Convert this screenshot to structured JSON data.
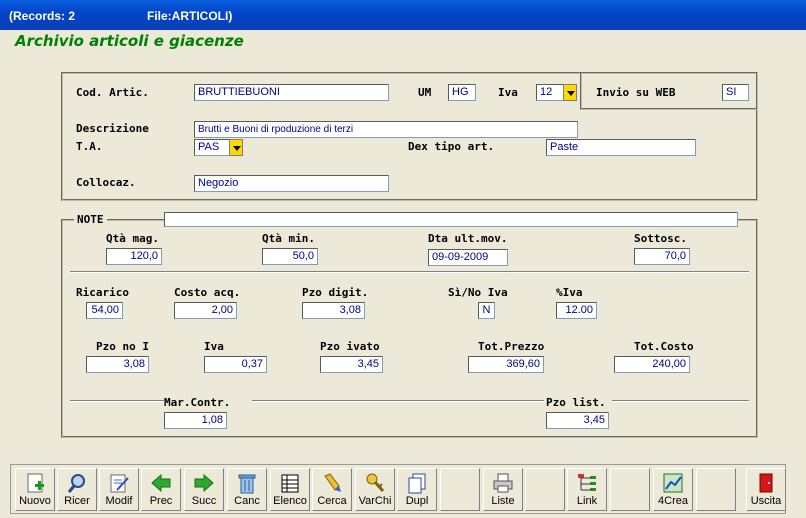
{
  "titlebar": {
    "records": "(Records: 2",
    "file": "File:ARTICOLI)"
  },
  "app_title": "Archivio articoli e giacenze",
  "header": {
    "cod_artic_label": "Cod. Artic.",
    "cod_artic_value": "BRUTTIEBUONI",
    "um_label": "UM",
    "um_value": "HG",
    "iva_label": "Iva",
    "iva_value": "12",
    "invio_web_label": "Invio su WEB",
    "invio_web_value": "SI",
    "descrizione_label": "Descrizione",
    "descrizione_value": "Brutti e Buoni di rpoduzione di terzi",
    "ta_label": "T.A.",
    "ta_value": "PAS",
    "dex_tipo_label": "Dex tipo art.",
    "dex_tipo_value": "Paste",
    "collocaz_label": "Collocaz.",
    "collocaz_value": "Negozio"
  },
  "stock": {
    "note_label": "NOTE",
    "note_value": "",
    "qta_mag_label": "Qtà mag.",
    "qta_mag_value": "120,0",
    "qta_min_label": "Qtà min.",
    "qta_min_value": "50,0",
    "dta_ult_label": "Dta ult.mov.",
    "dta_ult_value": "09-09-2009",
    "sottosc_label": "Sottosc.",
    "sottosc_value": "70,0",
    "ricarico_label": "Ricarico",
    "ricarico_value": "54,00",
    "costo_acq_label": "Costo acq.",
    "costo_acq_value": "2,00",
    "pzo_digit_label": "Pzo digit.",
    "pzo_digit_value": "3,08",
    "si_no_iva_label": "Sì/No Iva",
    "si_no_iva_value": "N",
    "perc_iva_label": "%Iva",
    "perc_iva_value": "12.00",
    "pzo_no_i_label": "Pzo no I",
    "pzo_no_i_value": "3,08",
    "iva_label": "Iva",
    "iva_value": "0,37",
    "pzo_ivato_label": "Pzo ivato",
    "pzo_ivato_value": "3,45",
    "tot_prezzo_label": "Tot.Prezzo",
    "tot_prezzo_value": "369,60",
    "tot_costo_label": "Tot.Costo",
    "tot_costo_value": "240,00",
    "mar_contr_label": "Mar.Contr.",
    "mar_contr_value": "1,08",
    "pzo_list_label": "Pzo list.",
    "pzo_list_value": "3,45"
  },
  "toolbar": [
    {
      "label": "Nuovo",
      "icon": "new-document-icon"
    },
    {
      "label": "Ricer",
      "icon": "search-icon"
    },
    {
      "label": "Modif",
      "icon": "edit-icon"
    },
    {
      "label": "Prec",
      "icon": "arrow-left-icon"
    },
    {
      "label": "Succ",
      "icon": "arrow-right-icon"
    },
    {
      "label": "Canc",
      "icon": "trash-icon"
    },
    {
      "label": "Elenco",
      "icon": "list-icon"
    },
    {
      "label": "Cerca",
      "icon": "highlighter-icon"
    },
    {
      "label": "VarChi",
      "icon": "keys-icon"
    },
    {
      "label": "Dupl",
      "icon": "duplicate-icon"
    },
    {
      "label": "",
      "icon": ""
    },
    {
      "label": "Liste",
      "icon": "printer-icon"
    },
    {
      "label": "",
      "icon": ""
    },
    {
      "label": "Link",
      "icon": "tree-icon"
    },
    {
      "label": "",
      "icon": ""
    },
    {
      "label": "4Crea",
      "icon": "chart-icon"
    },
    {
      "label": "",
      "icon": ""
    },
    {
      "label": "Uscita",
      "icon": "exit-door-icon"
    }
  ]
}
